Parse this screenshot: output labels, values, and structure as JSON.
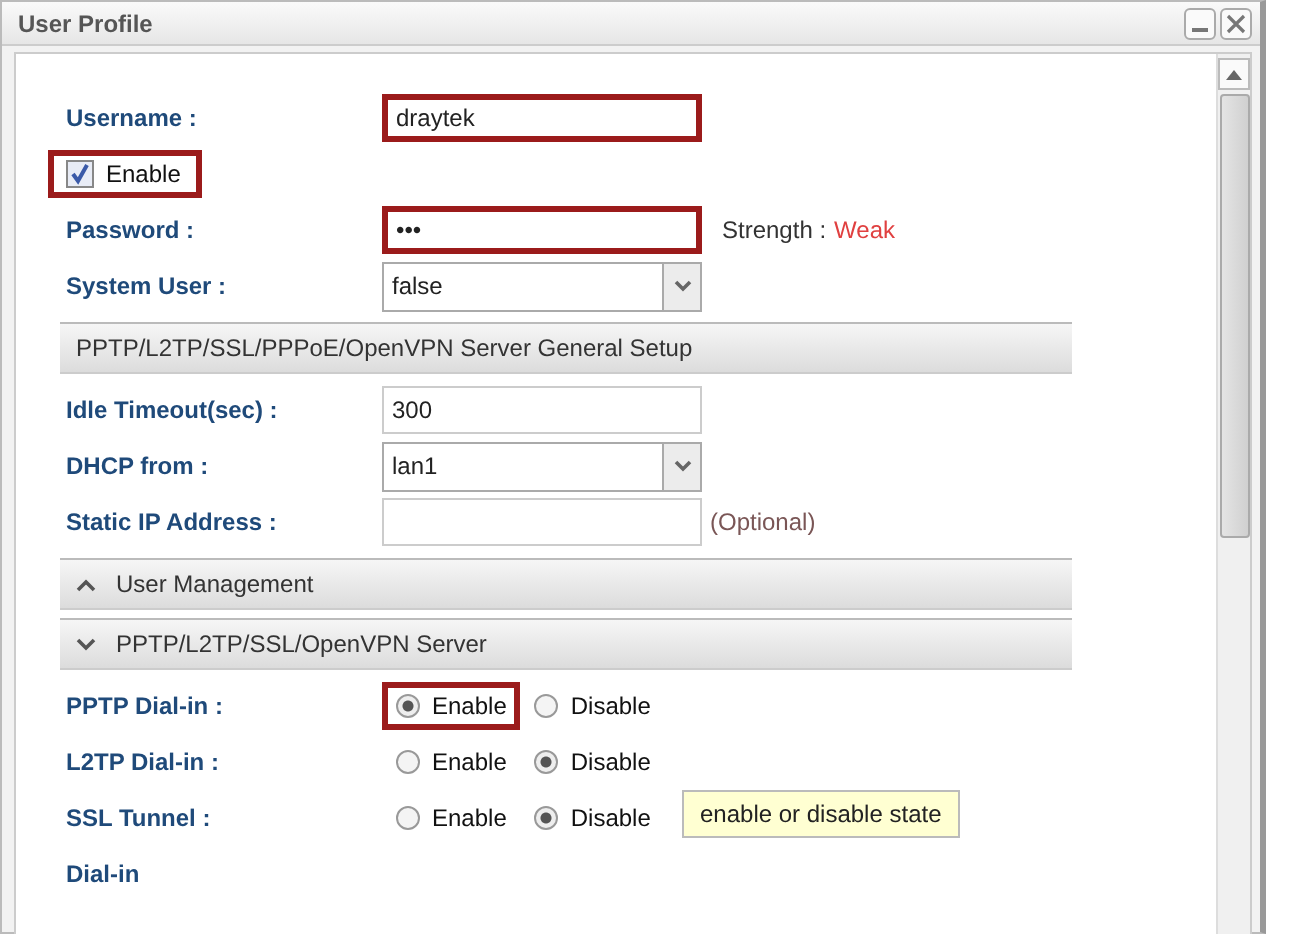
{
  "window": {
    "title": "User Profile"
  },
  "rows": [
    {
      "kind": "text",
      "label": "Username :",
      "value": "draytek",
      "highlighted": true
    },
    {
      "kind": "checkbox",
      "label": "Enable",
      "checked": true,
      "highlighted": true
    },
    {
      "kind": "password",
      "label": "Password :",
      "value": "•••",
      "highlighted": true,
      "note_label": "Strength :",
      "note_value": "Weak"
    },
    {
      "kind": "select",
      "label": "System User :",
      "value": "false"
    },
    {
      "kind": "header",
      "label": "PPTP/L2TP/SSL/PPPoE/OpenVPN Server General Setup"
    },
    {
      "kind": "text",
      "label": "Idle Timeout(sec) :",
      "value": "300",
      "highlighted": false
    },
    {
      "kind": "select",
      "label": "DHCP from :",
      "value": "lan1"
    },
    {
      "kind": "text",
      "label": "Static IP Address :",
      "highlighted": false,
      "note": "(Optional)"
    },
    {
      "kind": "header",
      "label": "User Management",
      "expanded": false
    },
    {
      "kind": "header",
      "label": "PPTP/L2TP/SSL/OpenVPN Server",
      "expanded": true
    },
    {
      "kind": "radio",
      "label": "PPTP Dial-in :",
      "options": [
        {
          "label": "Enable",
          "selected": true,
          "highlighted": true
        },
        {
          "label": "Disable",
          "selected": false,
          "highlighted": false
        }
      ]
    },
    {
      "kind": "radio",
      "label": "L2TP Dial-in :",
      "options": [
        {
          "label": "Enable",
          "selected": false,
          "highlighted": false
        },
        {
          "label": "Disable",
          "selected": true,
          "highlighted": false
        }
      ]
    },
    {
      "kind": "radio",
      "label": "SSL Tunnel :",
      "options": [
        {
          "label": "Enable",
          "selected": false,
          "highlighted": false
        },
        {
          "label": "Disable",
          "selected": true,
          "highlighted": false
        }
      ]
    },
    {
      "kind": "radio",
      "label": "Dial-in"
    }
  ],
  "tooltip": "enable or disable state"
}
